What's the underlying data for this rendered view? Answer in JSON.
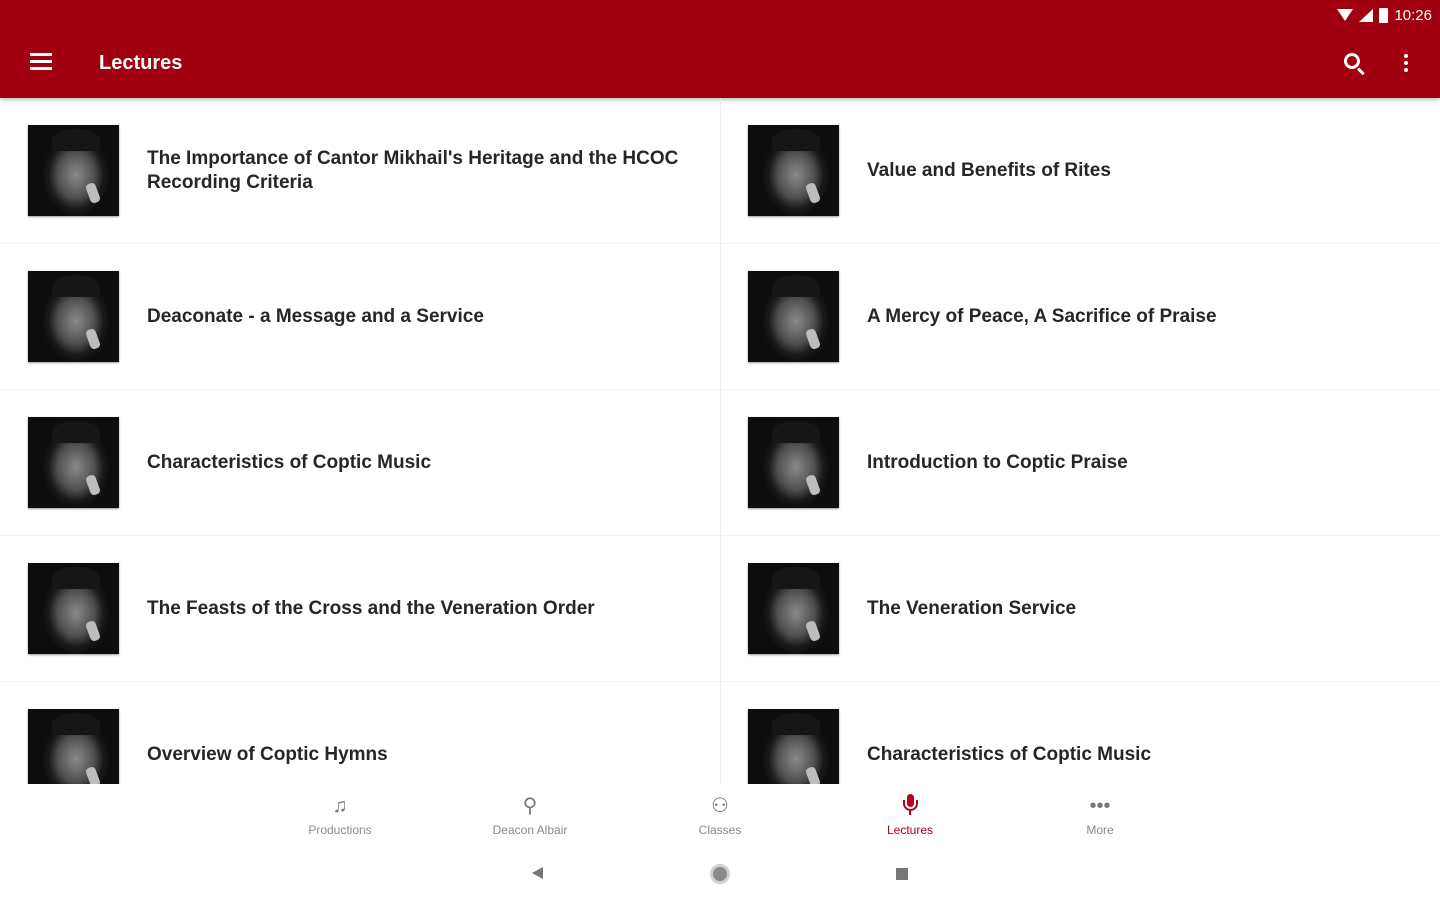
{
  "status_bar": {
    "time": "10:26",
    "icons": [
      "wifi-icon",
      "signal-icon",
      "battery-icon"
    ]
  },
  "app_bar": {
    "title": "Lectures",
    "menu_icon": "menu-icon",
    "search_icon": "search-icon",
    "overflow_icon": "more-vert-icon",
    "background_color": "#a0000f"
  },
  "lectures": [
    {
      "title": "The Importance of Cantor Mikhail's Heritage and the HCOC Recording Criteria"
    },
    {
      "title": "Value and Benefits of Rites"
    },
    {
      "title": "Deaconate - a Message and a Service"
    },
    {
      "title": "A Mercy of Peace, A Sacrifice of Praise"
    },
    {
      "title": "Characteristics of Coptic Music"
    },
    {
      "title": "Introduction to Coptic Praise"
    },
    {
      "title": "The Feasts of the Cross and the Veneration Order"
    },
    {
      "title": "The Veneration Service"
    },
    {
      "title": "Overview of Coptic Hymns"
    },
    {
      "title": "Characteristics of Coptic Music"
    }
  ],
  "bottom_nav": {
    "items": [
      {
        "label": "Productions",
        "icon": "music-note-icon"
      },
      {
        "label": "Deacon Albair",
        "icon": "person-icon"
      },
      {
        "label": "Classes",
        "icon": "classes-icon"
      },
      {
        "label": "Lectures",
        "icon": "mic-icon",
        "active": true
      },
      {
        "label": "More",
        "icon": "more-horiz-icon"
      }
    ],
    "active_color": "#b3001b"
  },
  "system_nav": {
    "icons": [
      "back-icon",
      "home-icon",
      "recents-icon"
    ]
  }
}
